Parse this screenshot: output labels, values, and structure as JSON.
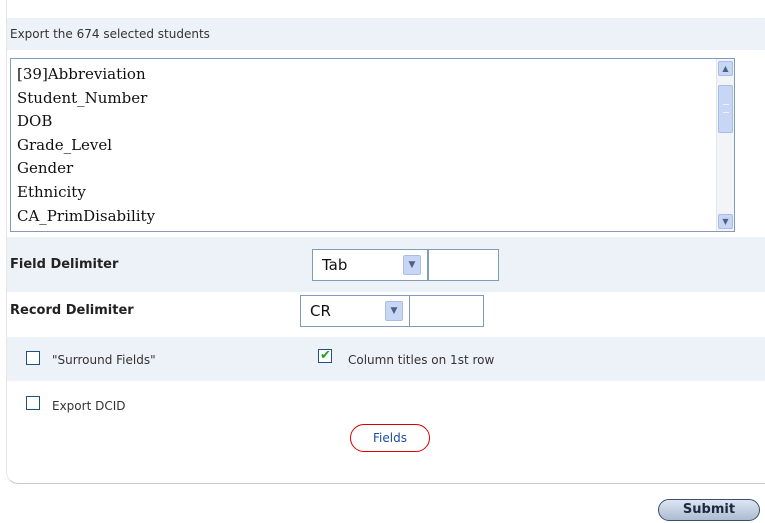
{
  "export": {
    "header": "Export the 674 selected students",
    "fields": [
      "[39]Abbreviation",
      "Student_Number",
      "DOB",
      "Grade_Level",
      "Gender",
      "Ethnicity",
      "CA_PrimDisability"
    ]
  },
  "field_delimiter": {
    "label": "Field Delimiter",
    "value": "Tab"
  },
  "record_delimiter": {
    "label": "Record Delimiter",
    "value": "CR"
  },
  "options": {
    "surround_fields": {
      "label": "\"Surround Fields\"",
      "checked": false
    },
    "column_titles": {
      "label": "Column titles on 1st row",
      "checked": true
    },
    "export_dcid": {
      "label": "Export DCID",
      "checked": false
    }
  },
  "buttons": {
    "fields": "Fields",
    "submit": "Submit"
  },
  "colors": {
    "band": "#edf1f8",
    "check": "#21a121",
    "fields_border": "#d60000",
    "link": "#1a4fa0"
  }
}
